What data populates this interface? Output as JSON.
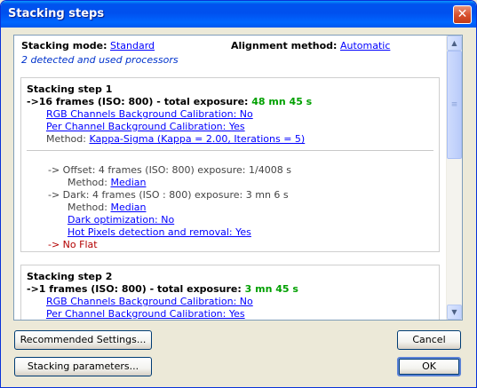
{
  "window": {
    "title": "Stacking steps",
    "close_symbol": "✕"
  },
  "header": {
    "mode_label": "Stacking mode:",
    "mode_value": "Standard",
    "alignment_label": "Alignment method:",
    "alignment_value": "Automatic",
    "processors": "2 detected and used processors"
  },
  "steps": [
    {
      "title": "Stacking step 1",
      "summary_prefix": "->16 frames (ISO: 800) - total exposure:",
      "summary_exposure": "48 mn 45 s",
      "rgb_calibration": "RGB Channels Background Calibration: No",
      "per_channel_calibration": "Per Channel Background Calibration: Yes",
      "method_label": "Method:",
      "method_value": "Kappa-Sigma (Kappa = 2.00, Iterations = 5)",
      "offset": "-> Offset: 4 frames (ISO: 800) exposure: 1/4008 s",
      "offset_method_label": "Method:",
      "offset_method_value": "Median",
      "dark": "-> Dark: 4 frames (ISO : 800) exposure: 3 mn 6 s",
      "dark_method_label": "Method:",
      "dark_method_value": "Median",
      "dark_optimization": "Dark optimization: No",
      "hot_pixels": "Hot Pixels detection and removal: Yes",
      "flat": "-> No Flat"
    },
    {
      "title": "Stacking step 2",
      "summary_prefix": "->1 frames (ISO: 800) - total exposure:",
      "summary_exposure": "3 mn 45 s",
      "rgb_calibration": "RGB Channels Background Calibration: No",
      "per_channel_calibration": "Per Channel Background Calibration: Yes"
    }
  ],
  "scrollbar": {
    "up_symbol": "▲",
    "down_symbol": "▼",
    "grip_symbol": "≡"
  },
  "buttons": {
    "recommended": "Recommended Settings...",
    "stacking_parameters": "Stacking parameters...",
    "cancel": "Cancel",
    "ok": "OK"
  },
  "colors": {
    "titlebar": "#0054e3",
    "link": "#0000ff",
    "exposure": "#00a000",
    "calibration_text": "#b30000"
  }
}
